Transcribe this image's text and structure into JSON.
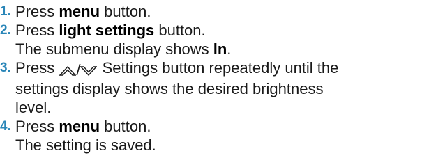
{
  "steps": [
    {
      "number": "1.",
      "pre": "Press ",
      "bold": "menu",
      "post": " button."
    },
    {
      "number": "2.",
      "pre": "Press ",
      "bold": "light settings",
      "post": " button.",
      "result_pre": "The submenu display shows ",
      "result_bold": "ln",
      "result_post": "."
    },
    {
      "number": "3.",
      "pre": "Press ",
      "icon_sep": "/",
      "line1_post": " Settings button repeatedly until the",
      "line2": "settings display shows the desired brightness",
      "line3": "level."
    },
    {
      "number": "4.",
      "pre": "Press ",
      "bold": "menu",
      "post": " button.",
      "result": "The setting is saved."
    }
  ],
  "colors": {
    "number": "#2a86b8",
    "text": "#1a1a1a"
  },
  "icons": [
    "chevron-up-icon",
    "chevron-down-icon"
  ]
}
